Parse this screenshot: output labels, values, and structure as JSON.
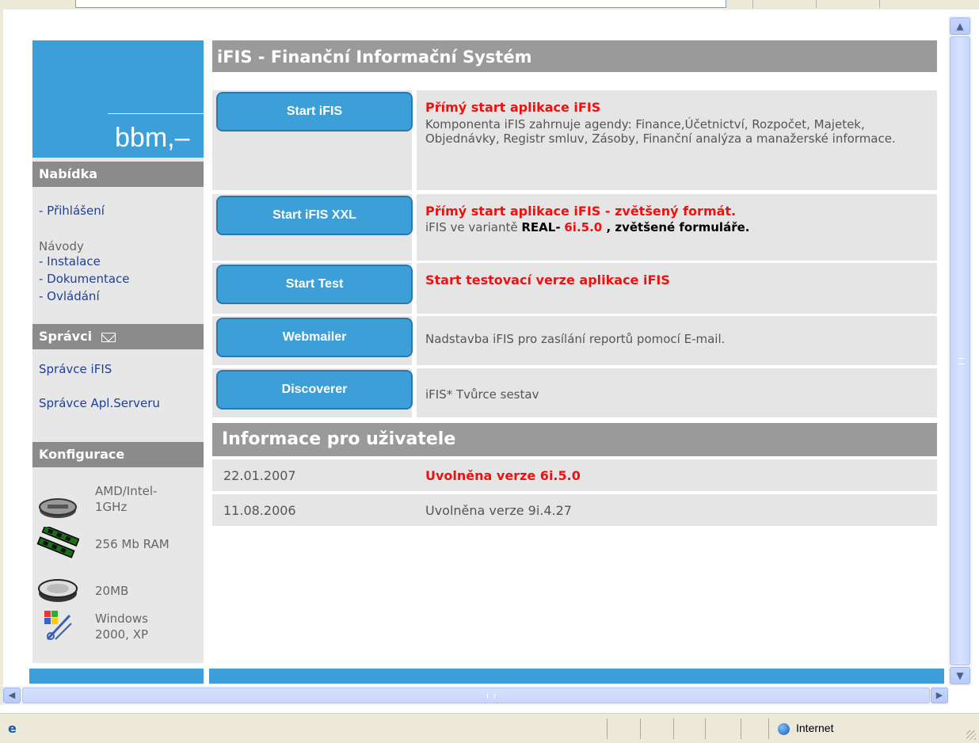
{
  "page": {
    "title": "iFIS - Finanční Informační Systém",
    "logo": "bbm,–"
  },
  "sidebar": {
    "menu_heading": "Nabídka",
    "login_link": "- Přihlášení",
    "guides_label": "Návody",
    "guides": [
      "- Instalace",
      "- Dokumentace",
      "- Ovládání"
    ],
    "admins_heading": "Správci",
    "admins": [
      "Správce iFIS",
      "Správce Apl.Serveru"
    ],
    "config_heading": "Konfigurace",
    "config": [
      {
        "icon": "cpu-icon",
        "label": "AMD/Intel-\n1GHz"
      },
      {
        "icon": "ram-icon",
        "label": "256 Mb RAM"
      },
      {
        "icon": "disk-icon",
        "label": "20MB"
      },
      {
        "icon": "windows-icon",
        "label": "Windows\n2000, XP"
      }
    ]
  },
  "actions": [
    {
      "button": "Start iFIS",
      "title": "Přímý start aplikace iFIS",
      "text": "Komponenta iFIS zahrnuje agendy: Finance,Účetnictví, Rozpočet, Majetek, Objednávky, Registr smluv, Zásoby, Finanční analýza a manažerské informace."
    },
    {
      "button": "Start iFIS XXL",
      "title": "Přímý start aplikace iFIS - zvětšený formát.",
      "text_prefix": "iFIS ve variantě ",
      "text_real": "REAL-",
      "text_version": "6i.5.0",
      "text_suffix": " , zvětšené formuláře."
    },
    {
      "button": "Start Test",
      "title": "Start testovací verze aplikace iFIS"
    },
    {
      "button": "Webmailer",
      "text": "Nadstavba iFIS pro zasílání reportů pomocí E-mail."
    },
    {
      "button": "Discoverer",
      "text": "iFIS* Tvůrce sestav"
    }
  ],
  "info": {
    "heading": "Informace pro uživatele",
    "rows": [
      {
        "date": "22.01.2007",
        "text": "Uvolněna verze 6i.5.0"
      },
      {
        "date": "11.08.2006",
        "text": "Uvolněna verze 9i.4.27"
      }
    ]
  },
  "statusbar": {
    "zone": "Internet"
  },
  "colors": {
    "brand_blue": "#3d9fd8",
    "header_gray": "#9a9a9a",
    "highlight_red": "#ee1111"
  }
}
